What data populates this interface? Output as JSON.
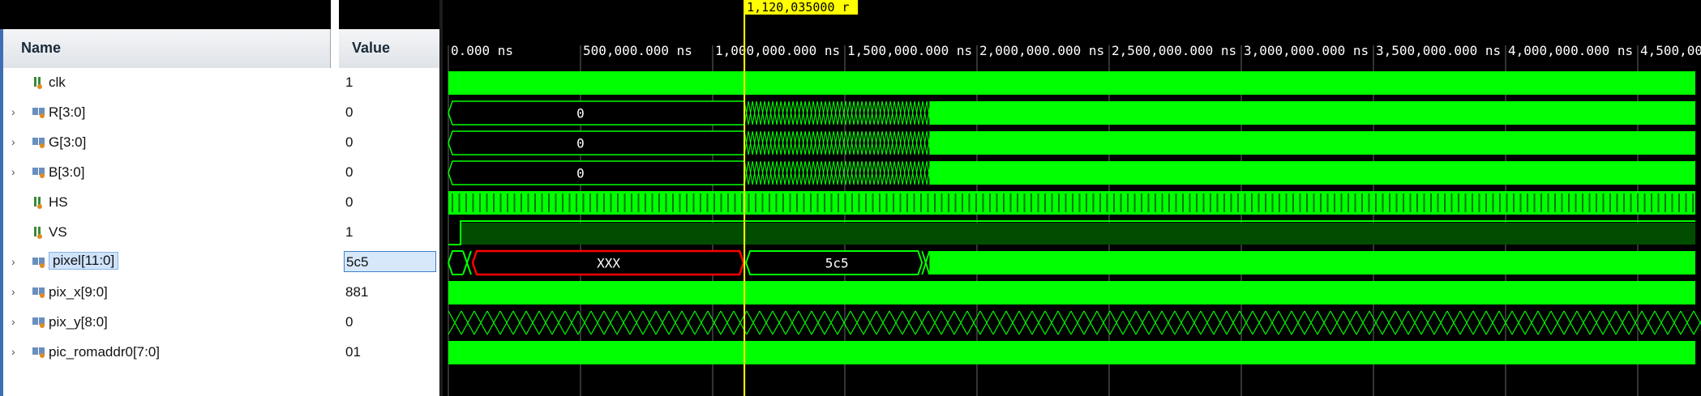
{
  "header": {
    "name_label": "Name",
    "value_label": "Value"
  },
  "cursor": {
    "label": "1,120,035000 r",
    "time_ns": 1120035
  },
  "timeline": {
    "ticks": [
      "0.000 ns",
      "500,000.000 ns",
      "1,000,000.000 ns",
      "1,500,000.000 ns",
      "2,000,000.000 ns",
      "2,500,000.000 ns",
      "3,000,000.000 ns",
      "3,500,000.000 ns",
      "4,000,000.000 ns",
      "4,500,000"
    ],
    "tick_values_ns": [
      0,
      500000,
      1000000,
      1500000,
      2000000,
      2500000,
      3000000,
      3500000,
      4000000,
      4500000
    ],
    "visible_range_ns": [
      0,
      4720000
    ]
  },
  "signals": [
    {
      "name": "clk",
      "value": "1",
      "kind": "bit",
      "expandable": false,
      "icon": "bit-signal-icon"
    },
    {
      "name": "R[3:0]",
      "value": "0",
      "kind": "bus",
      "expandable": true,
      "icon": "bus-signal-icon",
      "bus_label": "0"
    },
    {
      "name": "G[3:0]",
      "value": "0",
      "kind": "bus",
      "expandable": true,
      "icon": "bus-signal-icon",
      "bus_label": "0"
    },
    {
      "name": "B[3:0]",
      "value": "0",
      "kind": "bus",
      "expandable": true,
      "icon": "bus-signal-icon",
      "bus_label": "0"
    },
    {
      "name": "HS",
      "value": "0",
      "kind": "bit",
      "expandable": false,
      "icon": "bit-signal-icon"
    },
    {
      "name": "VS",
      "value": "1",
      "kind": "bit",
      "expandable": false,
      "icon": "bit-signal-icon"
    },
    {
      "name": "pixel[11:0]",
      "value": "5c5",
      "kind": "bus",
      "expandable": true,
      "icon": "bus-signal-icon",
      "selected": true,
      "bus_labels": [
        "XXX",
        "5c5"
      ]
    },
    {
      "name": "pix_x[9:0]",
      "value": "881",
      "kind": "bus",
      "expandable": true,
      "icon": "bus-signal-icon"
    },
    {
      "name": "pix_y[8:0]",
      "value": "0",
      "kind": "bus",
      "expandable": true,
      "icon": "bus-signal-icon"
    },
    {
      "name": "pic_romaddr0[7:0]",
      "value": "01",
      "kind": "bus",
      "expandable": true,
      "icon": "bus-signal-icon"
    }
  ],
  "colors": {
    "wave": "#00ff00",
    "wave_dim": "#004d00",
    "cursor": "#ffff00",
    "x_state": "#ff0000",
    "grid": "#666666"
  }
}
